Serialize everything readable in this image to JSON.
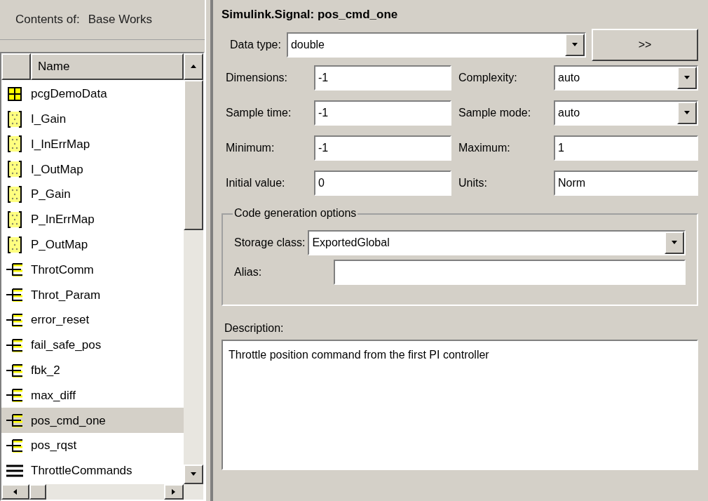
{
  "contents_header": {
    "label": "Contents of:",
    "workspace": "Base Works"
  },
  "list": {
    "column": "Name",
    "items": [
      {
        "name": "pcgDemoData",
        "kind": "struct",
        "selected": false
      },
      {
        "name": "I_Gain",
        "kind": "parameter",
        "selected": false
      },
      {
        "name": "I_InErrMap",
        "kind": "parameter",
        "selected": false
      },
      {
        "name": "I_OutMap",
        "kind": "parameter",
        "selected": false
      },
      {
        "name": "P_Gain",
        "kind": "parameter",
        "selected": false
      },
      {
        "name": "P_InErrMap",
        "kind": "parameter",
        "selected": false
      },
      {
        "name": "P_OutMap",
        "kind": "parameter",
        "selected": false
      },
      {
        "name": "ThrotComm",
        "kind": "signal",
        "selected": false
      },
      {
        "name": "Throt_Param",
        "kind": "signal",
        "selected": false
      },
      {
        "name": "error_reset",
        "kind": "signal",
        "selected": false
      },
      {
        "name": "fail_safe_pos",
        "kind": "signal",
        "selected": false
      },
      {
        "name": "fbk_2",
        "kind": "signal",
        "selected": false
      },
      {
        "name": "max_diff",
        "kind": "signal",
        "selected": false
      },
      {
        "name": "pos_cmd_one",
        "kind": "signal",
        "selected": true
      },
      {
        "name": "pos_rqst",
        "kind": "signal",
        "selected": false
      },
      {
        "name": "ThrottleCommands",
        "kind": "bus",
        "selected": false
      }
    ]
  },
  "editor": {
    "title": "Simulink.Signal: pos_cmd_one",
    "data_type": {
      "label": "Data type:",
      "value": "double"
    },
    "more_button": ">>",
    "fields": [
      {
        "label": "Dimensions:",
        "value": "-1",
        "kind": "text"
      },
      {
        "label": "Complexity:",
        "value": "auto",
        "kind": "dropdown"
      },
      {
        "label": "Sample time:",
        "value": "-1",
        "kind": "text"
      },
      {
        "label": "Sample mode:",
        "value": "auto",
        "kind": "dropdown"
      },
      {
        "label": "Minimum:",
        "value": "-1",
        "kind": "text"
      },
      {
        "label": "Maximum:",
        "value": "1",
        "kind": "text"
      },
      {
        "label": "Initial value:",
        "value": "0",
        "kind": "text"
      },
      {
        "label": "Units:",
        "value": "Norm",
        "kind": "text"
      }
    ],
    "code_generation": {
      "legend": "Code generation options",
      "storage_class": {
        "label": "Storage class:",
        "value": "ExportedGlobal"
      },
      "alias": {
        "label": "Alias:"
      }
    },
    "description": {
      "label": "Description:",
      "value": "Throttle position command from the first PI controller"
    }
  }
}
